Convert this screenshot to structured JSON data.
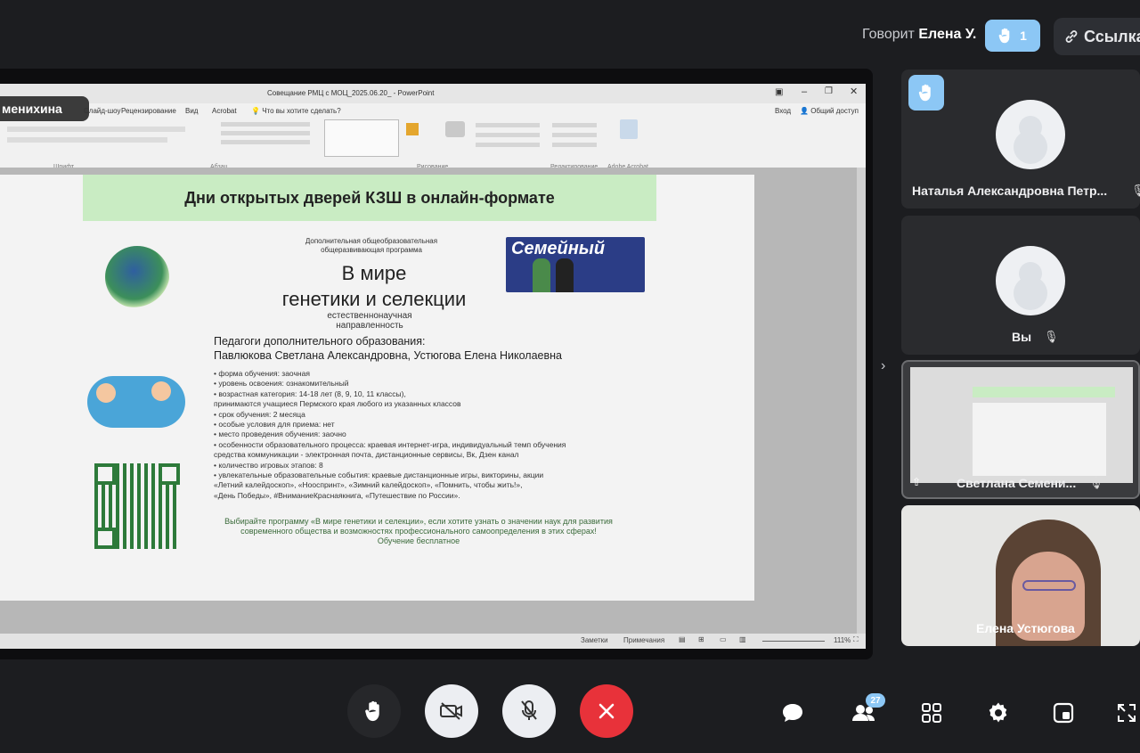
{
  "topbar": {
    "speaking_prefix": "Говорит",
    "speaking_name": "Елена У.",
    "raised_hands_count": "1",
    "link_label": "Ссылка"
  },
  "ppt": {
    "doc_title": "Совещание РМЦ с МОЦ_2025.06.20_ - PowerPoint",
    "account_name": "менихина",
    "tabs": [
      "Слайд-шоу",
      "Рецензирование",
      "Вид",
      "Acrobat"
    ],
    "search_placeholder": "Что вы хотите сделать?",
    "sign_in": "Вход",
    "share_label": "Общий доступ",
    "groups": [
      "Шрифт",
      "Абзац",
      "Рисование",
      "Редактирование",
      "Adobe Acrobat"
    ],
    "status_notes": "Заметки",
    "status_comments": "Примечания",
    "zoom": "111%"
  },
  "slide": {
    "banner": "Дни открытых дверей КЗШ в онлайн-формате",
    "prog_sub_1": "Дополнительная общеобразовательная",
    "prog_sub_2": "общеразвивающая программа",
    "prog_title_1": "В мире",
    "prog_title_2": "генетики и селекции",
    "prog_dir_1": "естественнонаучная",
    "prog_dir_2": "направленность",
    "teachers_label": "Педагоги дополнительного образования:",
    "teachers_names": "Павлюкова Светлана Александровна, Устюгова Елена Николаевна",
    "bullets": [
      "форма обучения: заочная",
      "уровень освоения: ознакомительный",
      "возрастная категория: 14-18 лет (8, 9, 10, 11 классы),",
      "принимаются учащиеся Пермского края любого из указанных классов",
      "срок обучения: 2 месяца",
      "особые условия для приема: нет",
      "место проведения обучения: заочно",
      "особенности образовательного процесса: краевая интернет-игра, индивидуальный темп обучения",
      "средства коммуникации - электронная почта, дистанционные сервисы, Вк, Дзен канал",
      "количество игровых этапов: 8",
      "увлекательные образовательные события: краевые дистанционные игры, викторины, акции",
      "«Летний калейдоскоп», «Нооспринт», «Зимний калейдоскоп», «Помнить, чтобы жить!»,",
      "«День Победы», #ВниманиеКраснаякнига, «Путешествие по России»."
    ],
    "footer_1": "Выбирайте программу «В мире генетики и селекции», если хотите узнать о значении наук для развития",
    "footer_2": "современного общества и возможностях профессионального самоопределения в этих сферах!",
    "footer_3": "Обучение бесплатное",
    "family_banner": "Семейный"
  },
  "participants": [
    {
      "name": "Наталья Александровна Петр..."
    },
    {
      "name": "Вы"
    },
    {
      "name": "Светлана Семени..."
    },
    {
      "name": "Елена Устюгова"
    }
  ],
  "controls": {
    "participants_count": "27"
  },
  "colors": {
    "accent_blue": "#8cc7f5",
    "end_call_red": "#e8323a",
    "slide_banner_green": "#c9ecc3"
  }
}
